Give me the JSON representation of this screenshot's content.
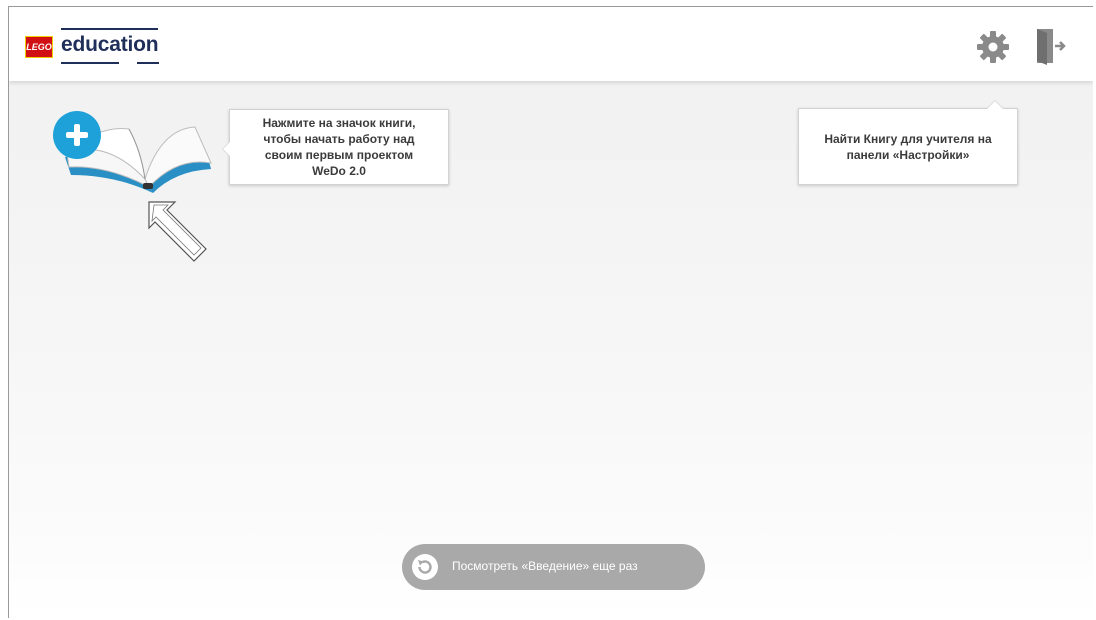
{
  "header": {
    "logo": {
      "brand": "LEGO",
      "word": "education",
      "brand_color": "#d01012",
      "word_color": "#1f2f5a"
    },
    "settings_icon": "gear-icon",
    "exit_icon": "exit-door-icon"
  },
  "main": {
    "new_project": {
      "icon": "book-icon",
      "plus_icon": "plus-icon",
      "accent": "#1ea0d8"
    },
    "tip_book": "Нажмите на значок книги, чтобы начать работу над своим первым проектом WeDo 2.0",
    "tip_settings": "Найти Книгу для учителя на панели «Настройки»",
    "pointer_icon": "outline-arrow-icon"
  },
  "footer": {
    "intro_button": {
      "label": "Посмотреть «Введение» еще раз",
      "icon": "replay-icon",
      "color": "#a9a9a9"
    }
  }
}
